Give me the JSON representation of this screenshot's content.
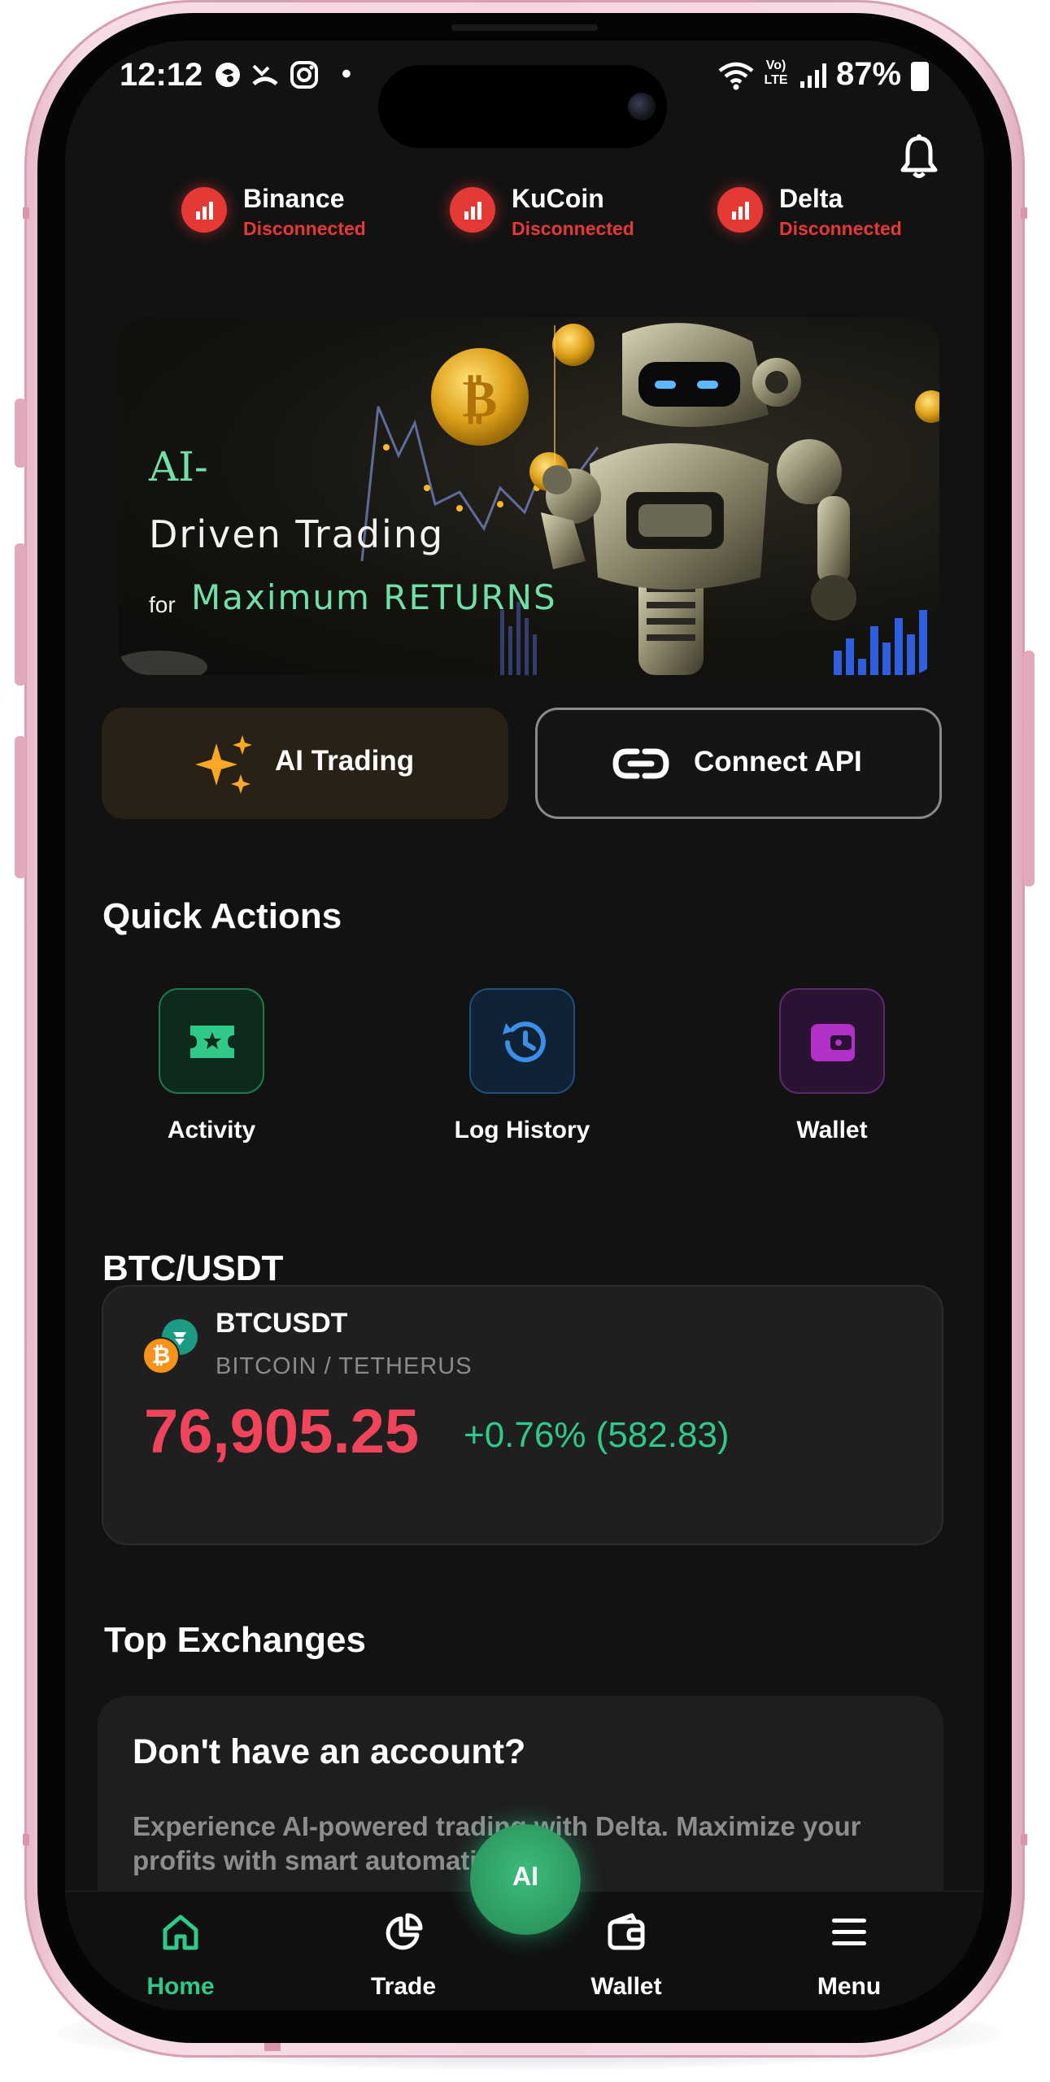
{
  "status_bar": {
    "time": "12:12",
    "dot": "•",
    "network_label": "Vo) LTE",
    "battery": "87%"
  },
  "exchanges": [
    {
      "name": "Binance",
      "status": "Disconnected"
    },
    {
      "name": "KuCoin",
      "status": "Disconnected"
    },
    {
      "name": "Delta",
      "status": "Disconnected"
    }
  ],
  "banner": {
    "line1": "AI-",
    "line2": "Driven Trading",
    "for_word": "for",
    "line3": "Maximum RETURNS"
  },
  "buttons": {
    "ai_trading": "AI Trading",
    "connect_api": "Connect API"
  },
  "quick_actions": {
    "title": "Quick Actions",
    "items": [
      {
        "label": "Activity",
        "icon": "ticket-star-icon"
      },
      {
        "label": "Log History",
        "icon": "history-icon"
      },
      {
        "label": "Wallet",
        "icon": "wallet-icon"
      }
    ]
  },
  "pair_section": {
    "title": "BTC/USDT",
    "symbol": "BTCUSDT",
    "subtitle": "BITCOIN / TETHERUS",
    "price": "76,905.25",
    "change": "+0.76% (582.83)"
  },
  "top_exchanges": {
    "title": "Top Exchanges",
    "card_title": "Don't have an account?",
    "card_body": "Experience AI-powered trading with Delta. Maximize your profits with smart automation."
  },
  "bottom_nav": {
    "items": [
      {
        "label": "Home",
        "icon": "home-icon",
        "active": true
      },
      {
        "label": "Trade",
        "icon": "pie-chart-icon",
        "active": false
      },
      {
        "label": "Wallet",
        "icon": "wallet-icon",
        "active": false
      },
      {
        "label": "Menu",
        "icon": "menu-icon",
        "active": false
      }
    ],
    "fab_label": "AI"
  },
  "colors": {
    "accent_green": "#2fc98a",
    "error_red": "#e53935",
    "price_red": "#f0445a",
    "background": "#121212"
  }
}
